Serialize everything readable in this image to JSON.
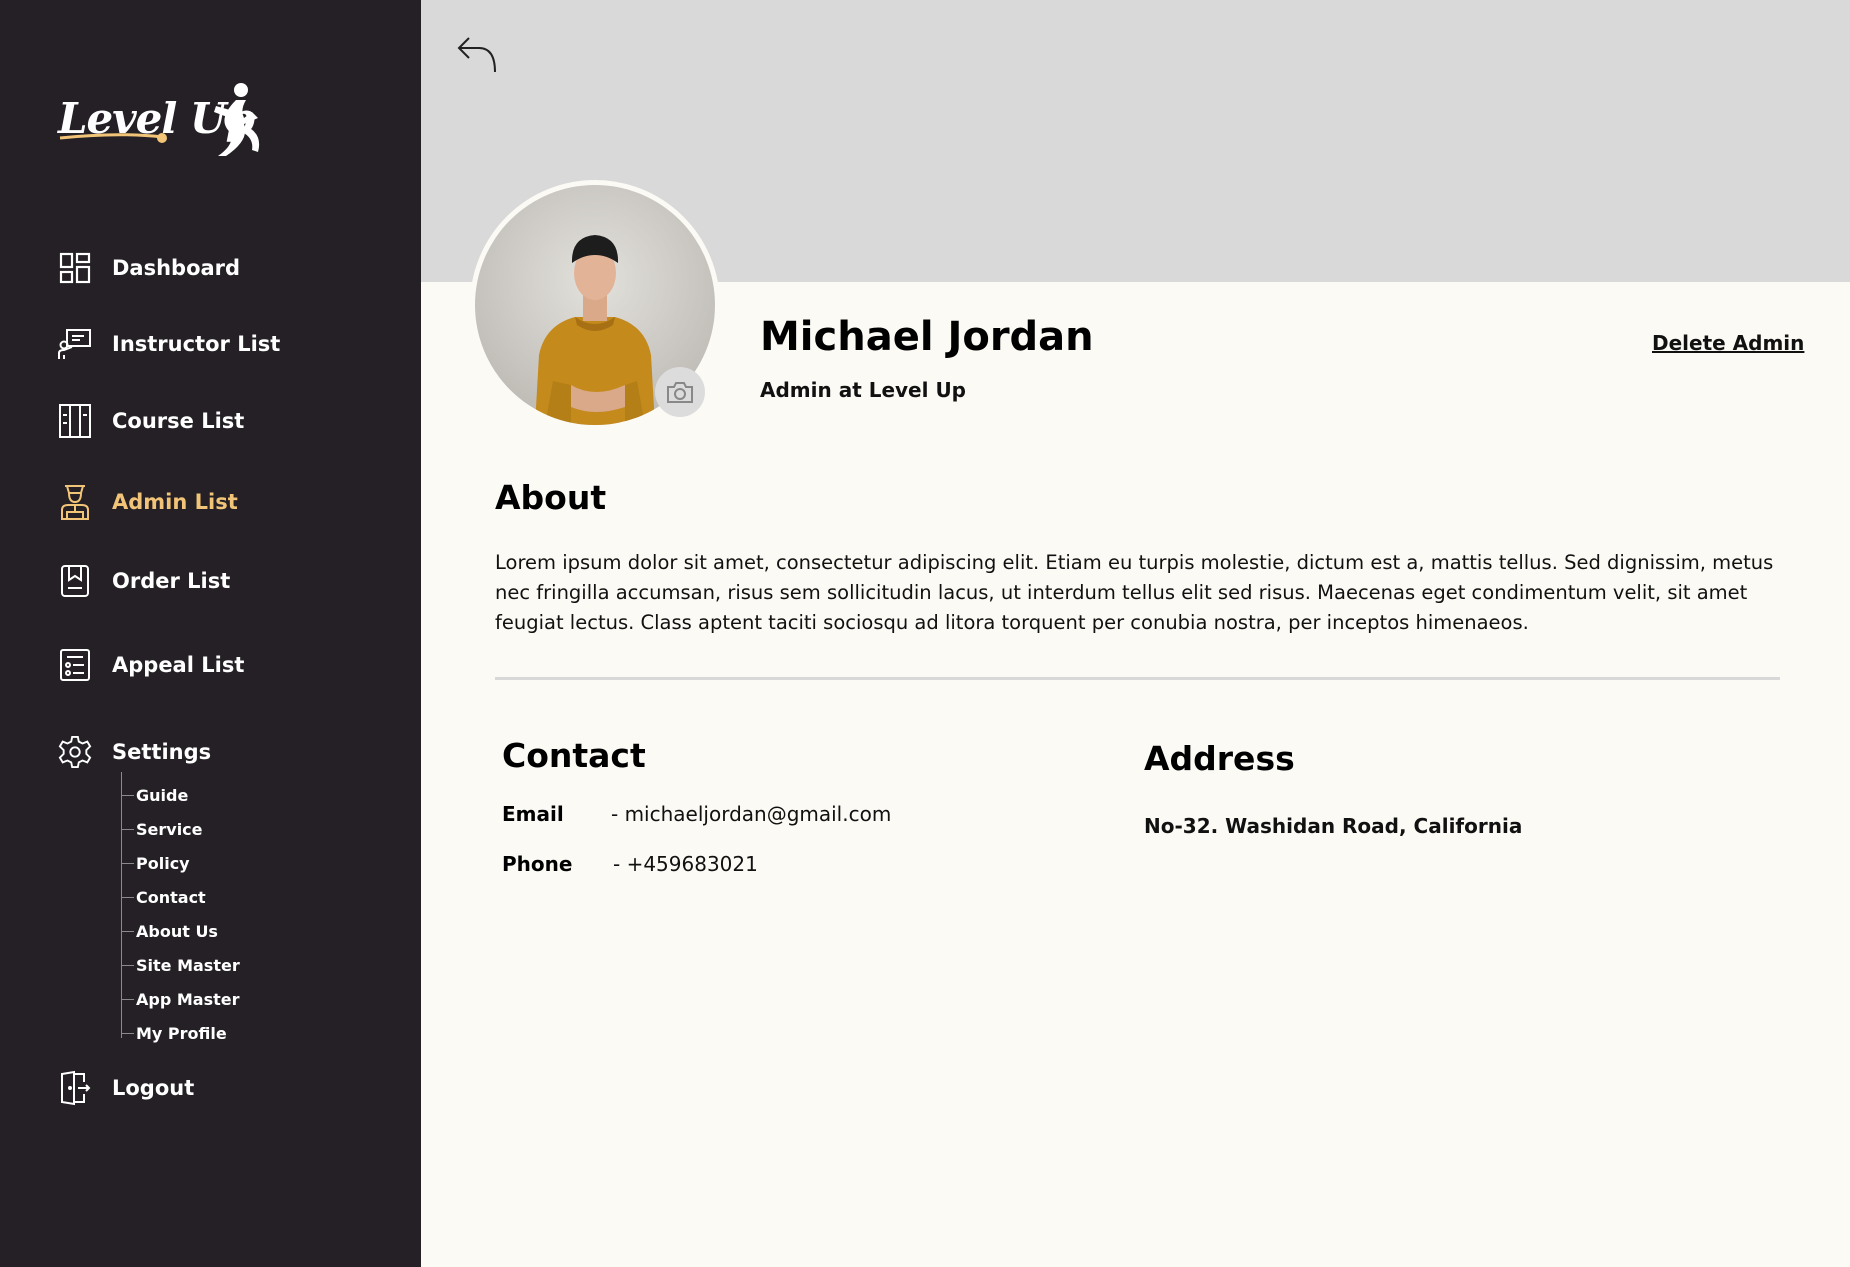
{
  "brand": {
    "name": "Level Up"
  },
  "sidebar": {
    "items": [
      {
        "label": "Dashboard",
        "icon": "dashboard-grid-icon"
      },
      {
        "label": "Instructor List",
        "icon": "instructor-board-icon"
      },
      {
        "label": "Course List",
        "icon": "course-book-icon"
      },
      {
        "label": "Admin List",
        "icon": "admin-user-icon",
        "active": true
      },
      {
        "label": "Order List",
        "icon": "order-bookmark-icon"
      },
      {
        "label": "Appeal List",
        "icon": "appeal-list-icon"
      },
      {
        "label": "Settings",
        "icon": "gear-icon"
      }
    ],
    "settings_sub": [
      "Guide",
      "Service",
      "Policy",
      "Contact",
      "About Us",
      "Site Master",
      "App Master",
      "My Profile"
    ],
    "logout": {
      "label": "Logout",
      "icon": "logout-door-icon"
    }
  },
  "profile": {
    "name": "Michael Jordan",
    "role": "Admin at Level Up",
    "delete_label": "Delete Admin"
  },
  "about": {
    "title": "About",
    "text": "Lorem ipsum dolor sit amet, consectetur adipiscing elit. Etiam eu turpis molestie, dictum est a, mattis tellus. Sed dignissim, metus nec fringilla accumsan, risus sem sollicitudin lacus, ut interdum tellus elit sed risus. Maecenas eget condimentum velit, sit amet feugiat lectus. Class aptent taciti sociosqu ad litora torquent per conubia nostra, per inceptos himenaeos."
  },
  "contact": {
    "title": "Contact",
    "email_label": "Email",
    "email_value": "- michaeljordan@gmail.com",
    "phone_label": "Phone",
    "phone_value": "- +459683021"
  },
  "address": {
    "title": "Address",
    "text": "No-32. Washidan Road, California"
  },
  "colors": {
    "sidebar_bg": "#242025",
    "accent": "#f2c477",
    "content_bg": "#fcfaf5",
    "banner_bg": "#d9d9d9"
  }
}
